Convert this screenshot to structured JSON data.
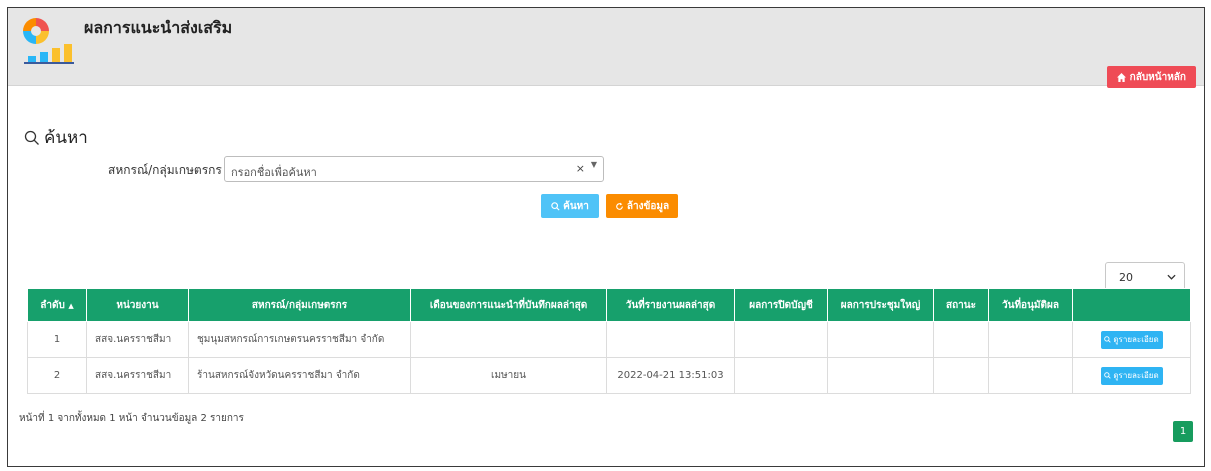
{
  "header": {
    "title": "ผลการแนะนำส่งเสริม",
    "logo_icon": "analytics-logo-icon",
    "home_button": "กลับหน้าหลัก",
    "home_icon": "home-icon"
  },
  "search": {
    "heading": "ค้นหา",
    "heading_icon": "search-icon",
    "filter_label": "สหกรณ์/กลุ่มเกษตรกร",
    "placeholder": "กรอกชื่อเพื่อค้นหา",
    "clear_symbol": "×",
    "search_button": "ค้นหา",
    "reset_button": "ล้างข้อมูล"
  },
  "table": {
    "page_size": "20",
    "columns": [
      "ลำดับ",
      "หน่วยงาน",
      "สหกรณ์/กลุ่มเกษตรกร",
      "เดือนของการแนะนำที่บันทึกผลล่าสุด",
      "วันที่รายงานผลล่าสุด",
      "ผลการปิดบัญชี",
      "ผลการประชุมใหญ่",
      "สถานะ",
      "วันที่อนุมัติผล",
      ""
    ],
    "sort_indicator": "▲",
    "detail_button": "ดูรายละเอียด",
    "rows": [
      {
        "no": "1",
        "agency": "สสจ.นครราชสีมา",
        "coop": "ชุมนุมสหกรณ์การเกษตรนครราชสีมา จำกัด",
        "month": "",
        "date": "",
        "closing": "",
        "meeting": "",
        "status": "",
        "approved": ""
      },
      {
        "no": "2",
        "agency": "สสจ.นครราชสีมา",
        "coop": "ร้านสหกรณ์จังหวัดนครราชสีมา จำกัด",
        "month": "เมษายน",
        "date": "2022-04-21 13:51:03",
        "closing": "",
        "meeting": "",
        "status": "",
        "approved": ""
      }
    ]
  },
  "footer": {
    "summary": "หน้าที่ 1 จากทั้งหมด 1 หน้า จำนวนข้อมูล 2 รายการ",
    "current_page": "1"
  },
  "colors": {
    "table_header": "#17a06c",
    "home_button": "#ef4b56",
    "search_button": "#4fc3f7",
    "reset_button": "#fb8c00",
    "pagination": "#179c5e"
  }
}
